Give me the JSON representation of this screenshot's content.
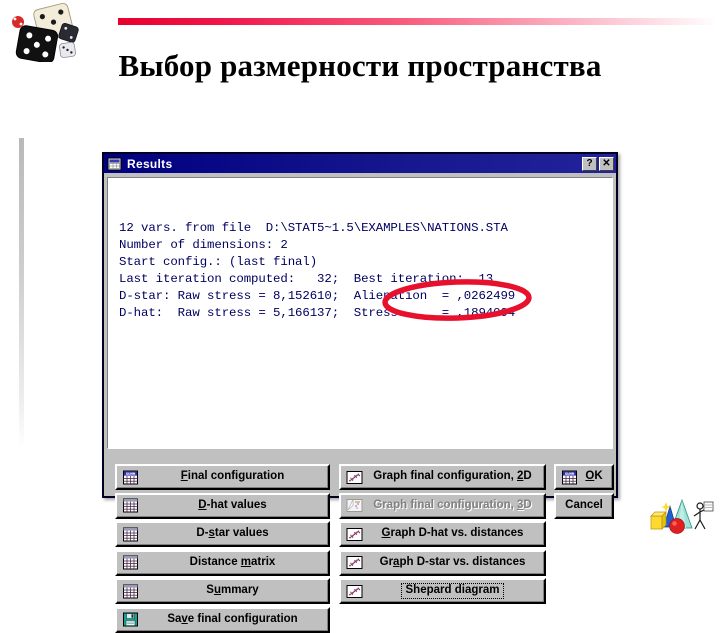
{
  "slide": {
    "title": "Выбор размерности пространства",
    "decorations": {
      "top_rule": "gradient-rule",
      "left_rule": "vertical-rule",
      "top_left_clipart": "dice-clipart",
      "bottom_right_clipart": "geometric-shapes-clipart"
    },
    "colors": {
      "rule_start": "#e8002e",
      "rule_end": "#ffffff",
      "title_color": "#000000",
      "annotation_red": "#e8112d",
      "titlebar_blue": "#000080",
      "dialog_face": "#c0c0c0"
    }
  },
  "dialog": {
    "title": "Results",
    "icon": "results-spreadsheet-icon",
    "titlebar_buttons": [
      {
        "name": "help-button",
        "label": "?"
      },
      {
        "name": "close-button",
        "label": "✕"
      }
    ],
    "output": {
      "lines": [
        "12 vars. from file  D:\\STAT5~1.5\\EXAMPLES\\NATIONS.STA",
        "Number of dimensions: 2",
        "Start config.: (last final)",
        "Last iteration computed:   32;  Best iteration:  13",
        "D-star: Raw stress = 8,152610;  Alienation  = ,0262499",
        "D-hat:  Raw stress = 5,166137;  Stress      = ,1894094"
      ],
      "fields": {
        "variables_count": "12",
        "source_file": "D:\\STAT5~1.5\\EXAMPLES\\NATIONS.STA",
        "number_of_dimensions": "2",
        "start_config": "(last final)",
        "last_iteration_computed": "32",
        "best_iteration": "13",
        "d_star_raw_stress": "8,152610",
        "alienation": ",0262499",
        "d_hat_raw_stress": "5,166137",
        "stress": ",1894094"
      },
      "annotation": {
        "shape": "red-ellipse",
        "highlights": "Stress = ,1894094"
      }
    },
    "buttons": {
      "left_column": [
        {
          "name": "final-configuration-button",
          "label": "Final configuration",
          "icon": "spreadsheet-summary-icon",
          "accel": "F",
          "state": "enabled"
        },
        {
          "name": "d-hat-values-button",
          "label": "D-hat values",
          "icon": "spreadsheet-icon",
          "accel": "D",
          "state": "enabled"
        },
        {
          "name": "d-star-values-button",
          "label": "D-star values",
          "icon": "spreadsheet-icon",
          "accel": "s",
          "state": "enabled"
        },
        {
          "name": "distance-matrix-button",
          "label": "Distance matrix",
          "icon": "spreadsheet-icon",
          "accel": "m",
          "state": "enabled"
        },
        {
          "name": "summary-button",
          "label": "Summary",
          "icon": "spreadsheet-icon",
          "accel": "u",
          "state": "enabled"
        },
        {
          "name": "save-final-configuration-button",
          "label": "Save final configuration",
          "icon": "floppy-disk-icon",
          "accel": "v",
          "state": "enabled"
        }
      ],
      "middle_column": [
        {
          "name": "graph-final-configuration-2d-button",
          "label": "Graph final configuration, 2D",
          "icon": "scatterplot-icon",
          "accel": "2",
          "state": "enabled"
        },
        {
          "name": "graph-final-configuration-3d-button",
          "label": "Graph final configuration, 3D",
          "icon": "scatterplot-3d-icon",
          "accel": "3",
          "state": "disabled"
        },
        {
          "name": "graph-d-hat-vs-distances-button",
          "label": "Graph D-hat vs. distances",
          "icon": "scatterplot-icon",
          "accel": "G",
          "state": "enabled"
        },
        {
          "name": "graph-d-star-vs-distances-button",
          "label": "Graph D-star vs. distances",
          "icon": "scatterplot-icon",
          "accel": "a",
          "state": "enabled"
        },
        {
          "name": "shepard-diagram-button",
          "label": "Shepard diagram",
          "icon": "scatterplot-icon",
          "accel": "",
          "state": "focused"
        }
      ],
      "right_column": [
        {
          "name": "ok-button",
          "label": "OK",
          "icon": "spreadsheet-summary-icon",
          "accel": "O",
          "state": "enabled"
        },
        {
          "name": "cancel-button",
          "label": "Cancel",
          "icon": "",
          "accel": "",
          "state": "enabled"
        }
      ]
    }
  }
}
